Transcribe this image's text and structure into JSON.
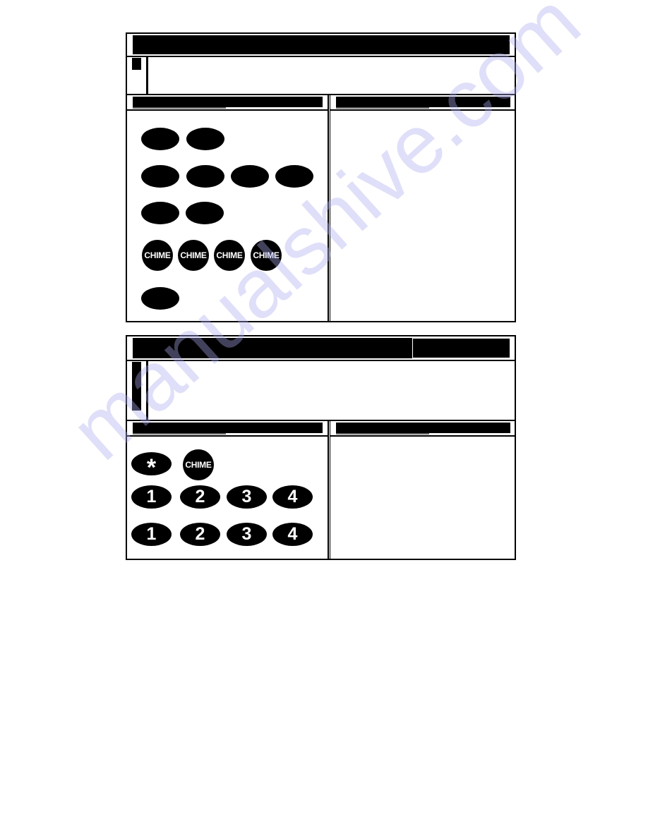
{
  "watermark": "manualshive.com",
  "sections": [
    {
      "title": "",
      "step_number": "",
      "step_text": "",
      "left_header": "",
      "right_header": "",
      "right_text": "",
      "keys": [
        {
          "shape": "oval",
          "label": ""
        },
        {
          "shape": "oval",
          "label": ""
        },
        {
          "shape": "oval",
          "label": ""
        },
        {
          "shape": "oval",
          "label": ""
        },
        {
          "shape": "oval",
          "label": ""
        },
        {
          "shape": "oval",
          "label": ""
        },
        {
          "shape": "oval",
          "label": ""
        },
        {
          "shape": "oval",
          "label": ""
        },
        {
          "shape": "chime",
          "label": "CHIME"
        },
        {
          "shape": "chime",
          "label": "CHIME"
        },
        {
          "shape": "chime",
          "label": "CHIME"
        },
        {
          "shape": "chime",
          "label": "CHIME"
        },
        {
          "shape": "oval",
          "label": ""
        }
      ]
    },
    {
      "title": "",
      "step_number": "",
      "step_text": "",
      "left_header": "",
      "right_header": "",
      "right_text": "",
      "keys": [
        {
          "shape": "star",
          "label": "*"
        },
        {
          "shape": "chime",
          "label": "CHIME"
        },
        {
          "shape": "oval2",
          "label": "1"
        },
        {
          "shape": "oval2",
          "label": "2"
        },
        {
          "shape": "oval2",
          "label": "3"
        },
        {
          "shape": "oval2",
          "label": "4"
        },
        {
          "shape": "oval2",
          "label": "1"
        },
        {
          "shape": "oval2",
          "label": "2"
        },
        {
          "shape": "oval2",
          "label": "3"
        },
        {
          "shape": "oval2",
          "label": "4"
        }
      ]
    }
  ]
}
